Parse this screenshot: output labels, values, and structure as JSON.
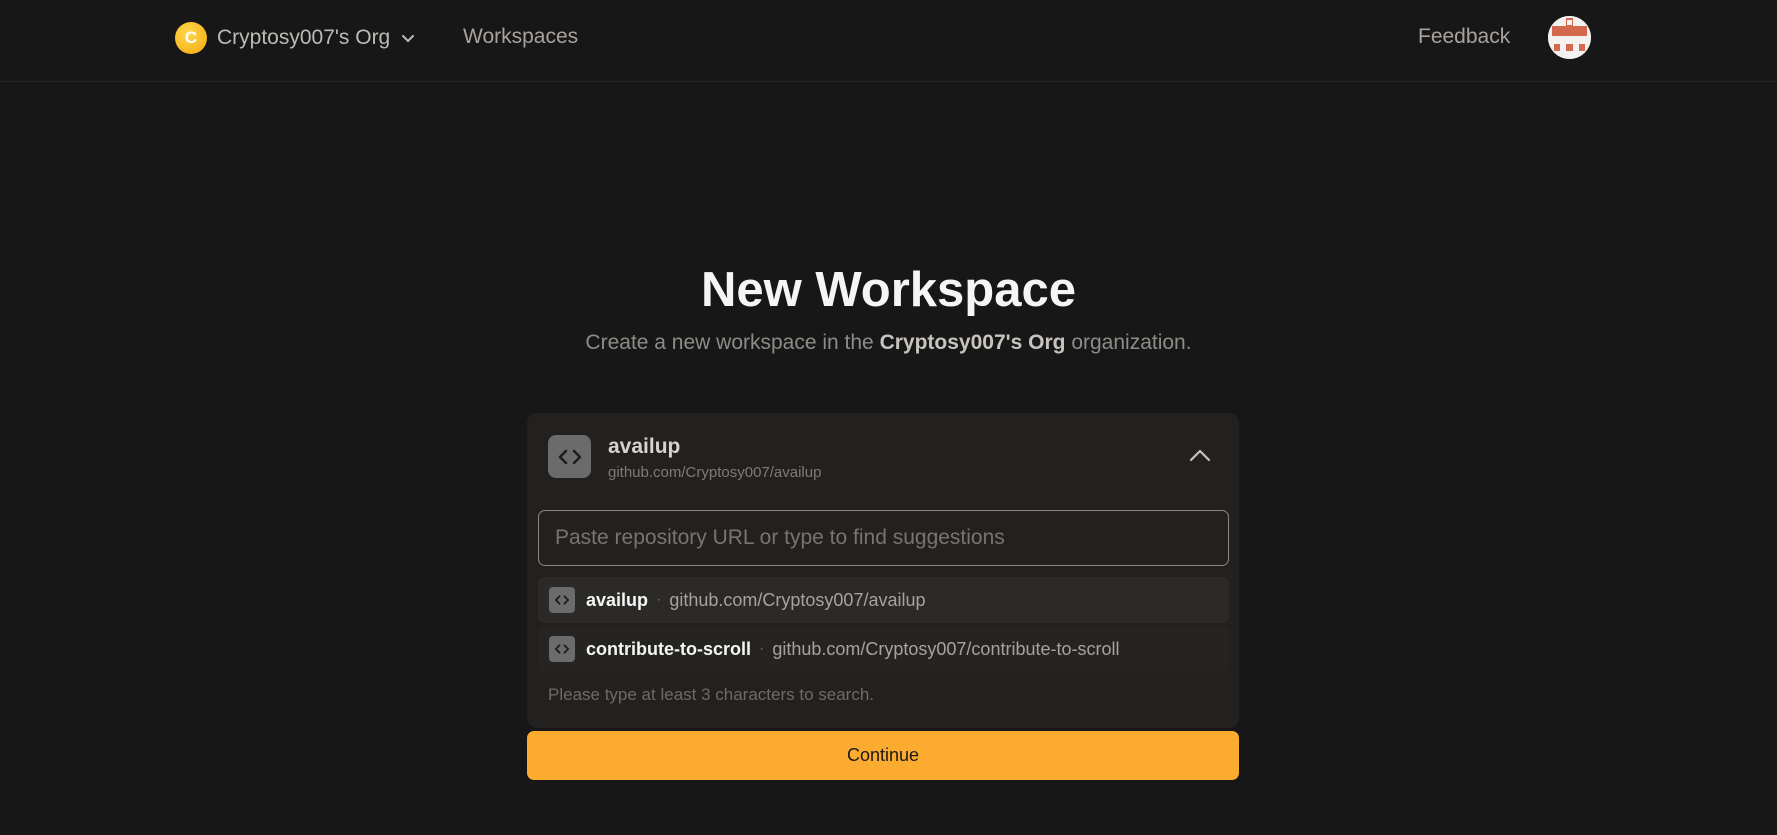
{
  "header": {
    "org_initial": "C",
    "org_name": "Cryptosy007's Org",
    "workspaces_link": "Workspaces",
    "feedback_link": "Feedback"
  },
  "page": {
    "title": "New Workspace",
    "subtitle_prefix": "Create a new workspace in the ",
    "subtitle_org": "Cryptosy007's Org",
    "subtitle_suffix": " organization."
  },
  "repo_selector": {
    "selected_name": "availup",
    "selected_url": "github.com/Cryptosy007/availup",
    "search_value": "",
    "search_placeholder": "Paste repository URL or type to find suggestions",
    "suggestions": [
      {
        "name": "availup",
        "separator": "·",
        "url": "github.com/Cryptosy007/availup"
      },
      {
        "name": "contribute-to-scroll",
        "separator": "·",
        "url": "github.com/Cryptosy007/contribute-to-scroll"
      }
    ],
    "hint": "Please type at least 3 characters to search."
  },
  "actions": {
    "continue_label": "Continue"
  },
  "colors": {
    "background": "#171717",
    "card": "#22211f",
    "accent": "#fbab30",
    "org_avatar": "#f5a70f"
  },
  "icons": [
    "chevron-down-icon",
    "code-brackets-icon",
    "chevron-up-icon"
  ]
}
